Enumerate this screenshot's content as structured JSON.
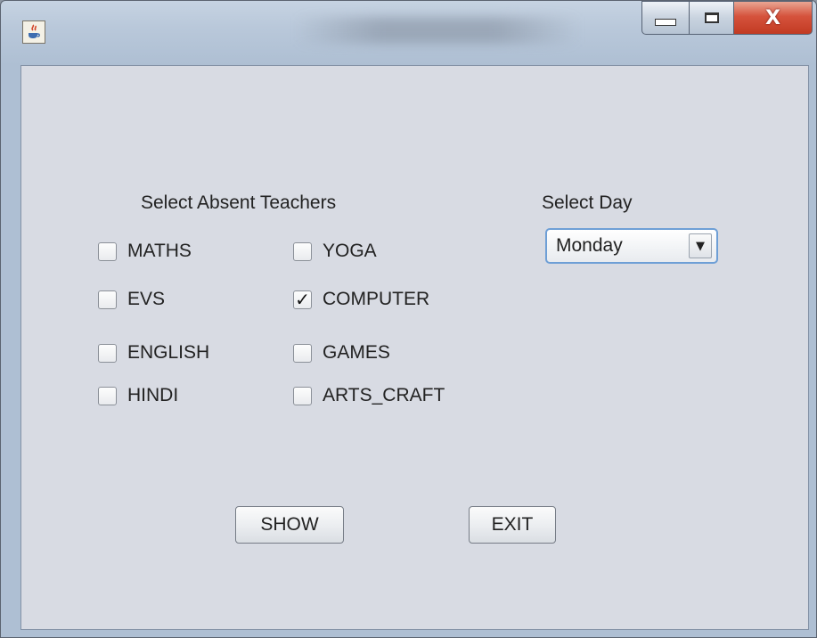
{
  "window": {
    "controls": {
      "minimize_icon": "minimize-icon",
      "maximize_icon": "maximize-icon",
      "close_icon": "close-icon",
      "close_glyph": "X"
    }
  },
  "teachers": {
    "heading": "Select Absent Teachers",
    "left_column": [
      {
        "label": "MATHS",
        "checked": false
      },
      {
        "label": "EVS",
        "checked": false
      },
      {
        "label": "ENGLISH",
        "checked": false
      },
      {
        "label": "HINDI",
        "checked": false
      }
    ],
    "right_column": [
      {
        "label": "YOGA",
        "checked": false
      },
      {
        "label": "COMPUTER",
        "checked": true
      },
      {
        "label": "GAMES",
        "checked": false
      },
      {
        "label": "ARTS_CRAFT",
        "checked": false
      }
    ]
  },
  "day": {
    "heading": "Select Day",
    "selected": "Monday"
  },
  "buttons": {
    "show": "SHOW",
    "exit": "EXIT"
  },
  "colors": {
    "client_bg": "#d8dbe3",
    "close_button": "#d5533d",
    "focus_border": "#6e9fd6"
  }
}
